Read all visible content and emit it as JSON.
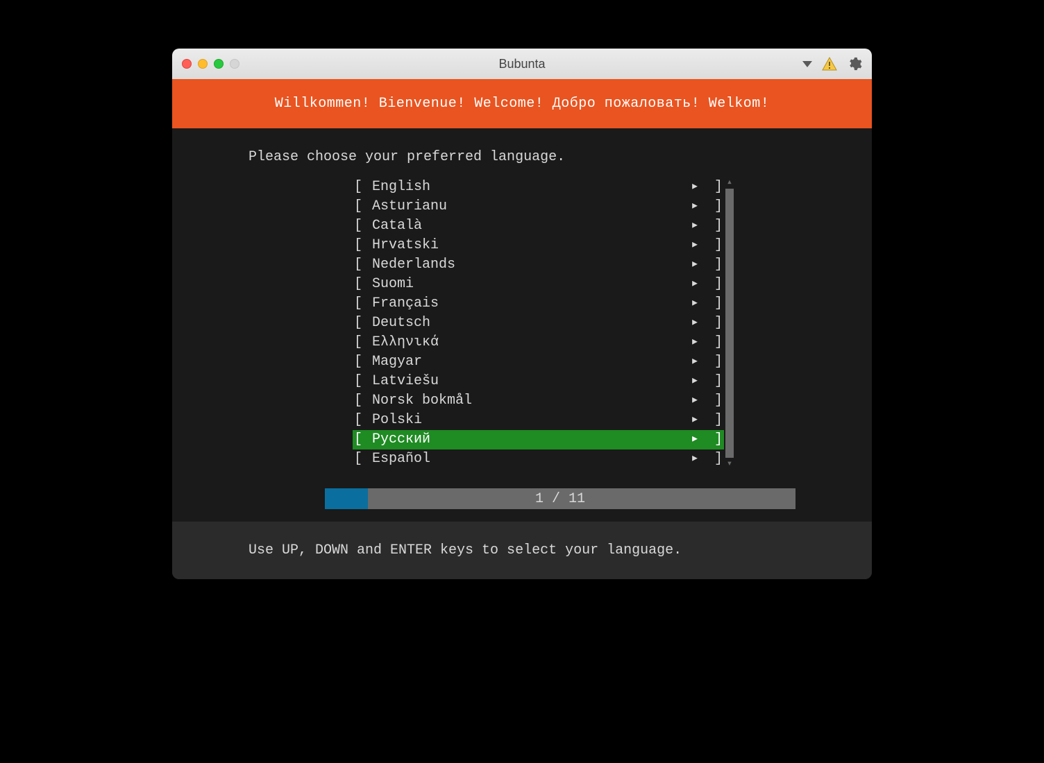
{
  "window": {
    "title": "Bubunta"
  },
  "banner": {
    "text": "Willkommen! Bienvenue! Welcome! Добро пожаловать! Welkom!"
  },
  "prompt": "Please choose your preferred language.",
  "languages": [
    {
      "label": "English",
      "selected": false
    },
    {
      "label": "Asturianu",
      "selected": false
    },
    {
      "label": "Català",
      "selected": false
    },
    {
      "label": "Hrvatski",
      "selected": false
    },
    {
      "label": "Nederlands",
      "selected": false
    },
    {
      "label": "Suomi",
      "selected": false
    },
    {
      "label": "Français",
      "selected": false
    },
    {
      "label": "Deutsch",
      "selected": false
    },
    {
      "label": "Ελληνικά",
      "selected": false
    },
    {
      "label": "Magyar",
      "selected": false
    },
    {
      "label": "Latviešu",
      "selected": false
    },
    {
      "label": "Norsk bokmål",
      "selected": false
    },
    {
      "label": "Polski",
      "selected": false
    },
    {
      "label": "Русский",
      "selected": true
    },
    {
      "label": "Español",
      "selected": false
    }
  ],
  "glyphs": {
    "bracket_left": "[",
    "bracket_right": "]",
    "triangle": "▸",
    "scroll_up": "▴",
    "scroll_down": "▾"
  },
  "progress": {
    "current": 1,
    "total": 11,
    "label": "1 / 11",
    "fill_percent": 9.09
  },
  "footer": {
    "hint": "Use UP, DOWN and ENTER keys to select your language."
  }
}
